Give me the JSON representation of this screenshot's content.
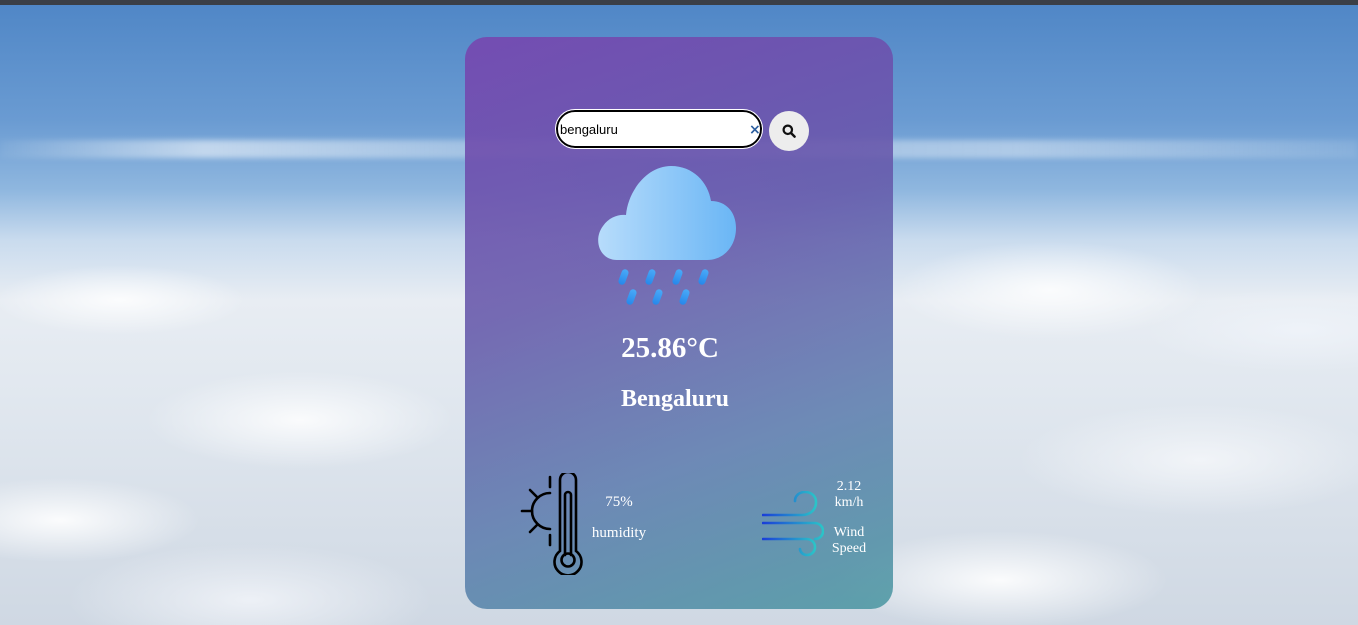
{
  "search": {
    "value": "bengaluru",
    "placeholder": "",
    "clear_icon": "×",
    "button_icon": "search-icon"
  },
  "weather": {
    "icon": "rain-cloud-icon",
    "temperature": "25.86°C",
    "city": "Bengaluru"
  },
  "details": {
    "humidity": {
      "icon": "humidity-thermometer-icon",
      "value": "75%",
      "label": "humidity"
    },
    "wind": {
      "icon": "wind-icon",
      "value": "2.12 km/h",
      "label": "Wind Speed"
    }
  },
  "colors": {
    "card_top": "#7648b0",
    "card_bottom": "#4896a0",
    "cloud": "#8fcaf8",
    "rain": "#2f93f0",
    "text": "#ffffff"
  }
}
